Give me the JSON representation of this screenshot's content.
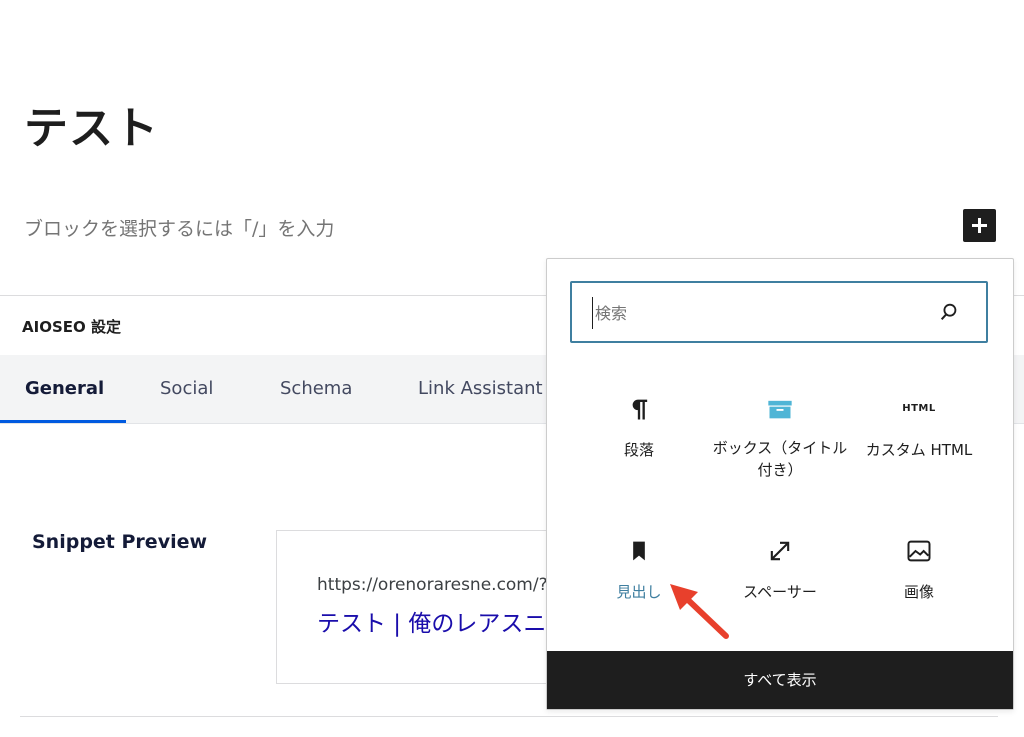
{
  "editor": {
    "post_title": "テスト",
    "block_placeholder": "ブロックを選択するには「/」を入力"
  },
  "aioseo": {
    "header": "AIOSEO 設定",
    "tabs": [
      "General",
      "Social",
      "Schema",
      "Link Assistant"
    ],
    "active_tab": "General",
    "accent_color": "#005ae0",
    "snippet": {
      "label": "Snippet Preview",
      "url": "https://orenoraresne.com/?",
      "title": "テスト | 俺のレアスニ"
    }
  },
  "inserter": {
    "search_placeholder": "検索",
    "blocks": [
      {
        "label": "段落",
        "icon": "paragraph-icon"
      },
      {
        "label": "ボックス（タイトル付き）",
        "icon": "box-icon"
      },
      {
        "label": "カスタム HTML",
        "icon": "html-icon",
        "icon_text": "HTML"
      },
      {
        "label": "見出し",
        "icon": "bookmark-icon"
      },
      {
        "label": "スペーサー",
        "icon": "resize-icon"
      },
      {
        "label": "画像",
        "icon": "image-icon"
      }
    ],
    "browse_all": "すべて表示",
    "highlight_color": "#3f7fa0",
    "box_icon_color": "#4fb5d6"
  },
  "annotation": {
    "arrow_color": "#e8402c"
  }
}
